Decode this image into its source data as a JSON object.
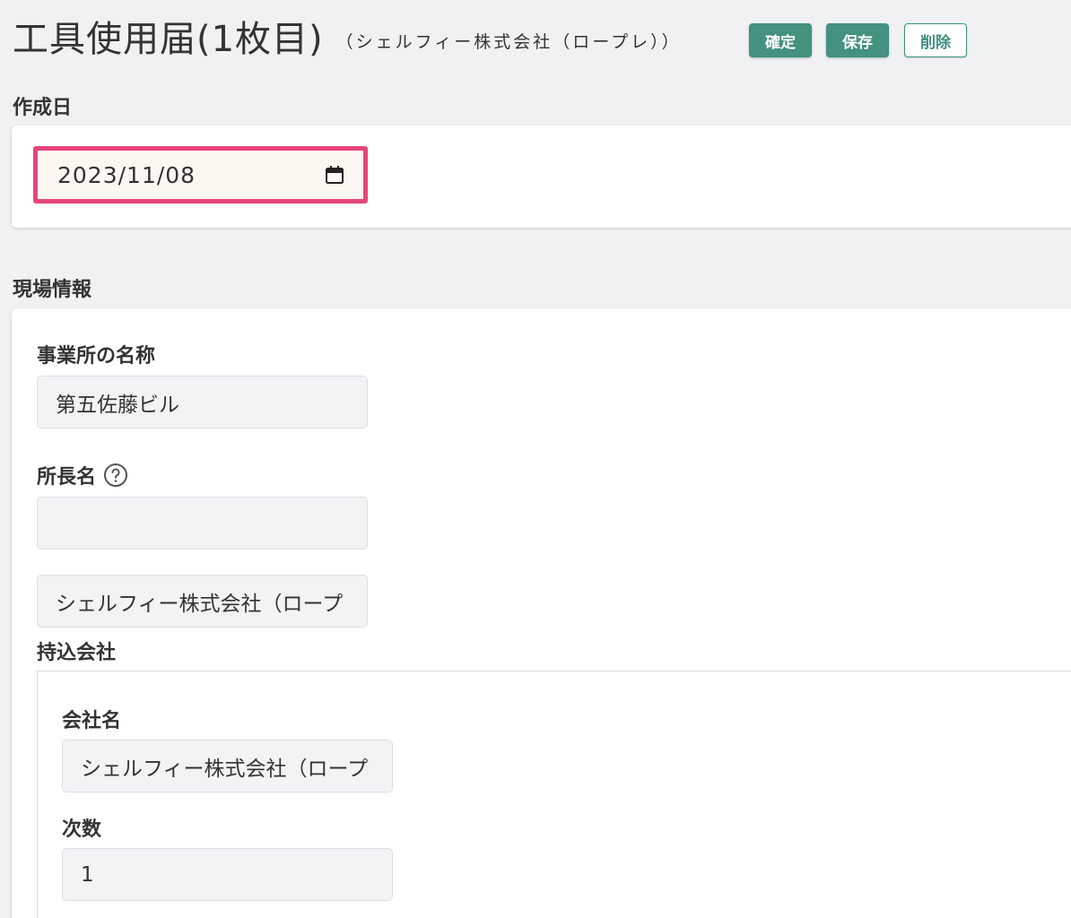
{
  "header": {
    "title": "工具使用届(1枚目)",
    "subtitle": "（シェルフィー株式会社（ロープレ））",
    "confirm_label": "確定",
    "save_label": "保存",
    "delete_label": "削除"
  },
  "creation_date": {
    "label": "作成日",
    "value": "2023/11/08"
  },
  "site_info": {
    "label": "現場情報",
    "office_name_label": "事業所の名称",
    "office_name_value": "第五佐藤ビル",
    "director_label": "所長名",
    "director_value": "",
    "company_field_value": "シェルフィー株式会社（ロープ"
  },
  "bring_in_company": {
    "label": "持込会社",
    "company_name_label": "会社名",
    "company_name_value": "シェルフィー株式会社（ロープ",
    "tier_label": "次数",
    "tier_value": "1"
  },
  "colors": {
    "accent": "#44917f",
    "highlight_border": "#e64679",
    "background": "#f0f1f3"
  }
}
